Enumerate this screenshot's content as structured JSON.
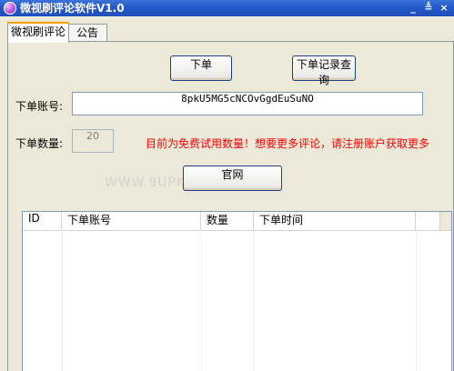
{
  "window": {
    "title": "微视刷评论软件V1.0",
    "controls": {
      "minimize": "_",
      "restore": "≜",
      "close": "×"
    }
  },
  "tabs": [
    {
      "label": "微视刷评论"
    },
    {
      "label": "公告"
    }
  ],
  "buttons": {
    "order": "下单",
    "order_history": "下单记录查询",
    "website": "官网"
  },
  "form": {
    "account_label": "下单账号:",
    "account_value": "8pkU5MG5cNCOvGgdEuSuNO",
    "quantity_label": "下单数量:",
    "quantity_value": "20",
    "notice": "目前为免费试用数量！想要更多评论，请注册账户获取更多"
  },
  "watermark": "WWW.9UPK.COM",
  "table": {
    "columns": [
      "ID",
      "下单账号",
      "数量",
      "下单时间"
    ]
  },
  "colors": {
    "accent": "#ff9f00",
    "warning": "#ff0000",
    "title": "#2358c9"
  }
}
